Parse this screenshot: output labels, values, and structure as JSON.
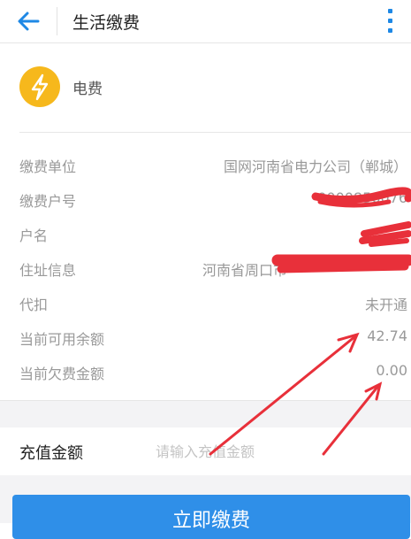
{
  "header": {
    "title": "生活缴费",
    "back_icon": "arrow-left-icon",
    "more_icon": "more-vertical-icon"
  },
  "bill_type": {
    "label": "电费",
    "icon": "lightning-bolt-icon",
    "icon_color": "#f6b81c"
  },
  "info_rows": [
    {
      "label": "缴费单位",
      "value": "国网河南省电力公司（郸城）"
    },
    {
      "label": "缴费户号",
      "value": "0000856076"
    },
    {
      "label": "户名",
      "value": ""
    },
    {
      "label": "住址信息",
      "value": "河南省周口市"
    },
    {
      "label": "代扣",
      "value": "未开通"
    },
    {
      "label": "当前可用余额",
      "value": "42.74"
    },
    {
      "label": "当前欠费金额",
      "value": "0.00"
    }
  ],
  "recharge": {
    "label": "充值金额",
    "placeholder": "请输入充值金额",
    "value": ""
  },
  "pay_button": {
    "label": "立即缴费"
  },
  "colors": {
    "accent": "#2f8fe8",
    "annotation": "#e8303a"
  }
}
